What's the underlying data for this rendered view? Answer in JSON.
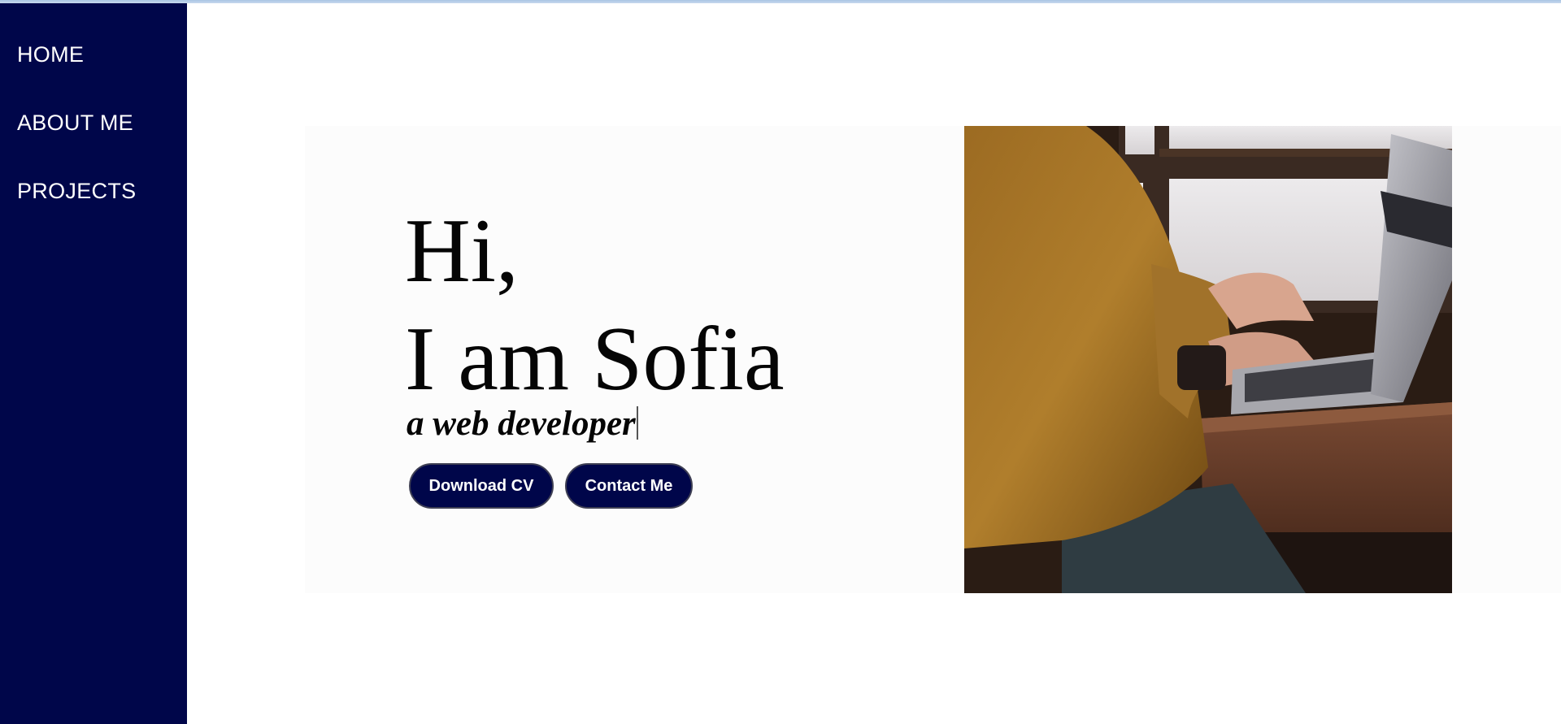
{
  "nav": {
    "items": [
      {
        "label": "HOME"
      },
      {
        "label": "ABOUT ME"
      },
      {
        "label": "PROJECTS"
      }
    ]
  },
  "hero": {
    "greeting": "Hi,",
    "name_line": "I am Sofia",
    "role": "a web developer",
    "buttons": {
      "download_cv": "Download CV",
      "contact_me": "Contact Me"
    }
  },
  "colors": {
    "sidebar": "#00064a",
    "button": "#00064a",
    "hero_background": "#fcfcfc"
  }
}
